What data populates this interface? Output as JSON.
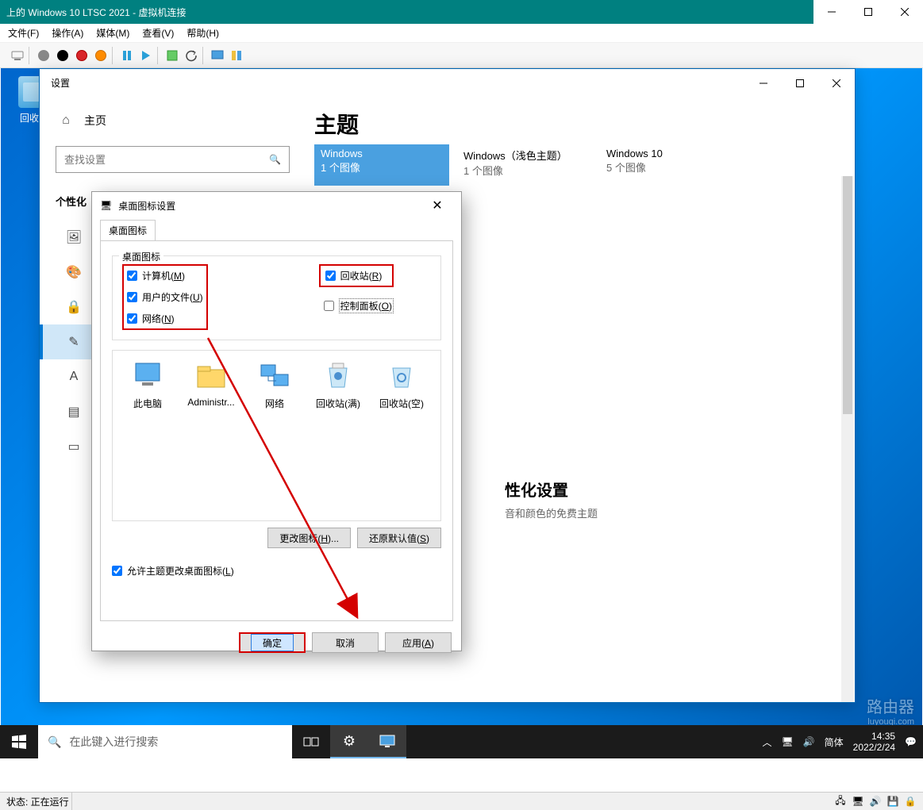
{
  "vmTitle": "上的 Windows 10 LTSC 2021 - 虚拟机连接",
  "menubar": {
    "file": "文件(F)",
    "action": "操作(A)",
    "media": "媒体(M)",
    "view": "查看(V)",
    "help": "帮助(H)"
  },
  "desktop": {
    "recycle": "回收站"
  },
  "settings": {
    "title": "设置",
    "home": "主页",
    "searchPlaceholder": "查找设置",
    "section": "个性化",
    "nav": {
      "background": "背景",
      "colors": "颜色",
      "lock": "锁屏界面",
      "themes": "主题",
      "fonts": "字体",
      "start": "开始",
      "taskbar": "任务栏"
    },
    "pageTitle": "主题",
    "cards": {
      "c1name": "Windows",
      "c1count": "1 个图像",
      "c2name": "Windows（浅色主题）",
      "c2count": "1 个图像",
      "c3name": "Windows 10",
      "c3count": "5 个图像"
    },
    "moreHeading": "性化设置",
    "moreSub": "音和颜色的免费主题"
  },
  "dlg": {
    "title": "桌面图标设置",
    "tab": "桌面图标",
    "legend": "桌面图标",
    "chk": {
      "computer": "计算机(M)",
      "userfiles": "用户的文件(U)",
      "network": "网络(N)",
      "recycle": "回收站(R)",
      "control": "控制面板(O)"
    },
    "icons": {
      "thispc": "此电脑",
      "admin": "Administr...",
      "network": "网络",
      "recycleFull": "回收站(满)",
      "recycleEmpty": "回收站(空)"
    },
    "changeIcon": "更改图标(H)...",
    "restore": "还原默认值(S)",
    "allowThemes": "允许主题更改桌面图标(L)",
    "ok": "确定",
    "cancel": "取消",
    "apply": "应用(A)"
  },
  "taskbar": {
    "search": "在此键入进行搜索",
    "ime": "简体",
    "time": "14:35",
    "date": "2022/2/24"
  },
  "status": {
    "text": "状态: 正在运行"
  },
  "watermark": {
    "main": "路由器",
    "sub": "luyouqi.com"
  }
}
